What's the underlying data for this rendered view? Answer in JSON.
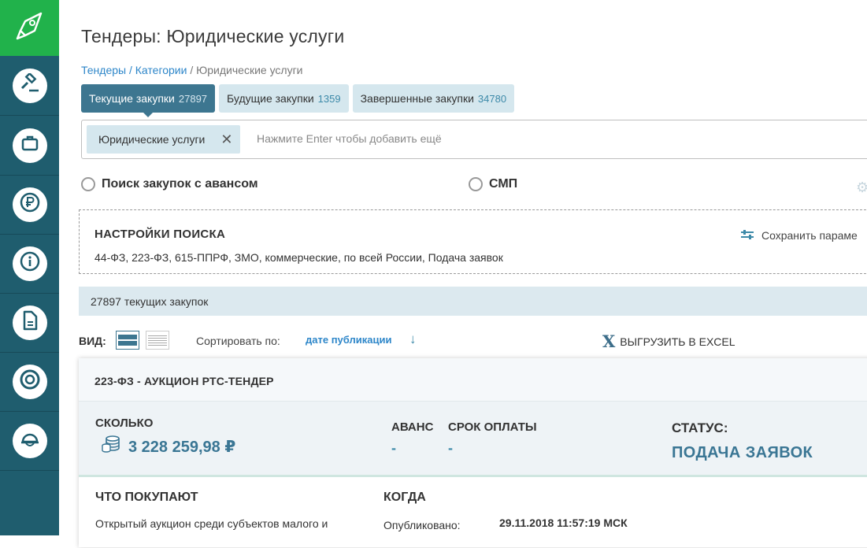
{
  "sidebar": {
    "logo_icon": "paper-plane-icon",
    "items": [
      {
        "icon": "gavel-icon"
      },
      {
        "icon": "briefcase-icon"
      },
      {
        "icon": "ruble-icon"
      },
      {
        "icon": "info-icon"
      },
      {
        "icon": "document-icon"
      },
      {
        "icon": "lifebuoy-icon"
      },
      {
        "icon": "helmet-icon"
      }
    ],
    "colors": {
      "background": "#1f5d6e",
      "logo_bg": "#21b24b"
    }
  },
  "page": {
    "title": "Тендеры: Юридические услуги"
  },
  "breadcrumb": {
    "link1": "Тендеры",
    "sep1": " / ",
    "link2": "Категории",
    "sep2": " / ",
    "current": "Юридические услуги"
  },
  "tabs": [
    {
      "label": "Текущие закупки",
      "count": "27897",
      "active": true
    },
    {
      "label": "Будущие закупки",
      "count": "1359",
      "active": false
    },
    {
      "label": "Завершенные закупки",
      "count": "34780",
      "active": false
    }
  ],
  "search": {
    "chip_label": "Юридические услуги",
    "chip_remove": "✕",
    "placeholder": "Нажмите Enter чтобы добавить ещё"
  },
  "filters": {
    "advance_label": "Поиск закупок с авансом",
    "smp_label": "СМП"
  },
  "settings": {
    "title": "НАСТРОЙКИ ПОИСКА",
    "description": "44-ФЗ, 223-ФЗ, 615-ППРФ, ЗМО, коммерческие, по всей России, Подача заявок",
    "save_label": "Сохранить параме"
  },
  "results": {
    "count_text": "27897 текущих закупок"
  },
  "toolbar": {
    "view_label": "ВИД:",
    "sort_label": "Сортировать по:",
    "sort_value": "дате публикации",
    "excel_label": "ВЫГРУЗИТЬ В EXCEL"
  },
  "card": {
    "header": "223-ФЗ - АУКЦИОН РТС-ТЕНДЕР",
    "amount_label": "СКОЛЬКО",
    "amount": "3 228 259,98 ₽",
    "advance_label": "АВАНС",
    "advance_value": "-",
    "payment_label": "СРОК ОПЛАТЫ",
    "payment_value": "-",
    "status_label": "СТАТУС:",
    "status_value": "ПОДАЧА ЗАЯВОК",
    "what_label": "ЧТО ПОКУПАЮТ",
    "what_text": "Открытый аукцион среди субъектов малого и",
    "when_label": "КОГДА",
    "published_label": "Опубликовано:",
    "published_value": "29.11.2018 11:57:19 МСК"
  }
}
